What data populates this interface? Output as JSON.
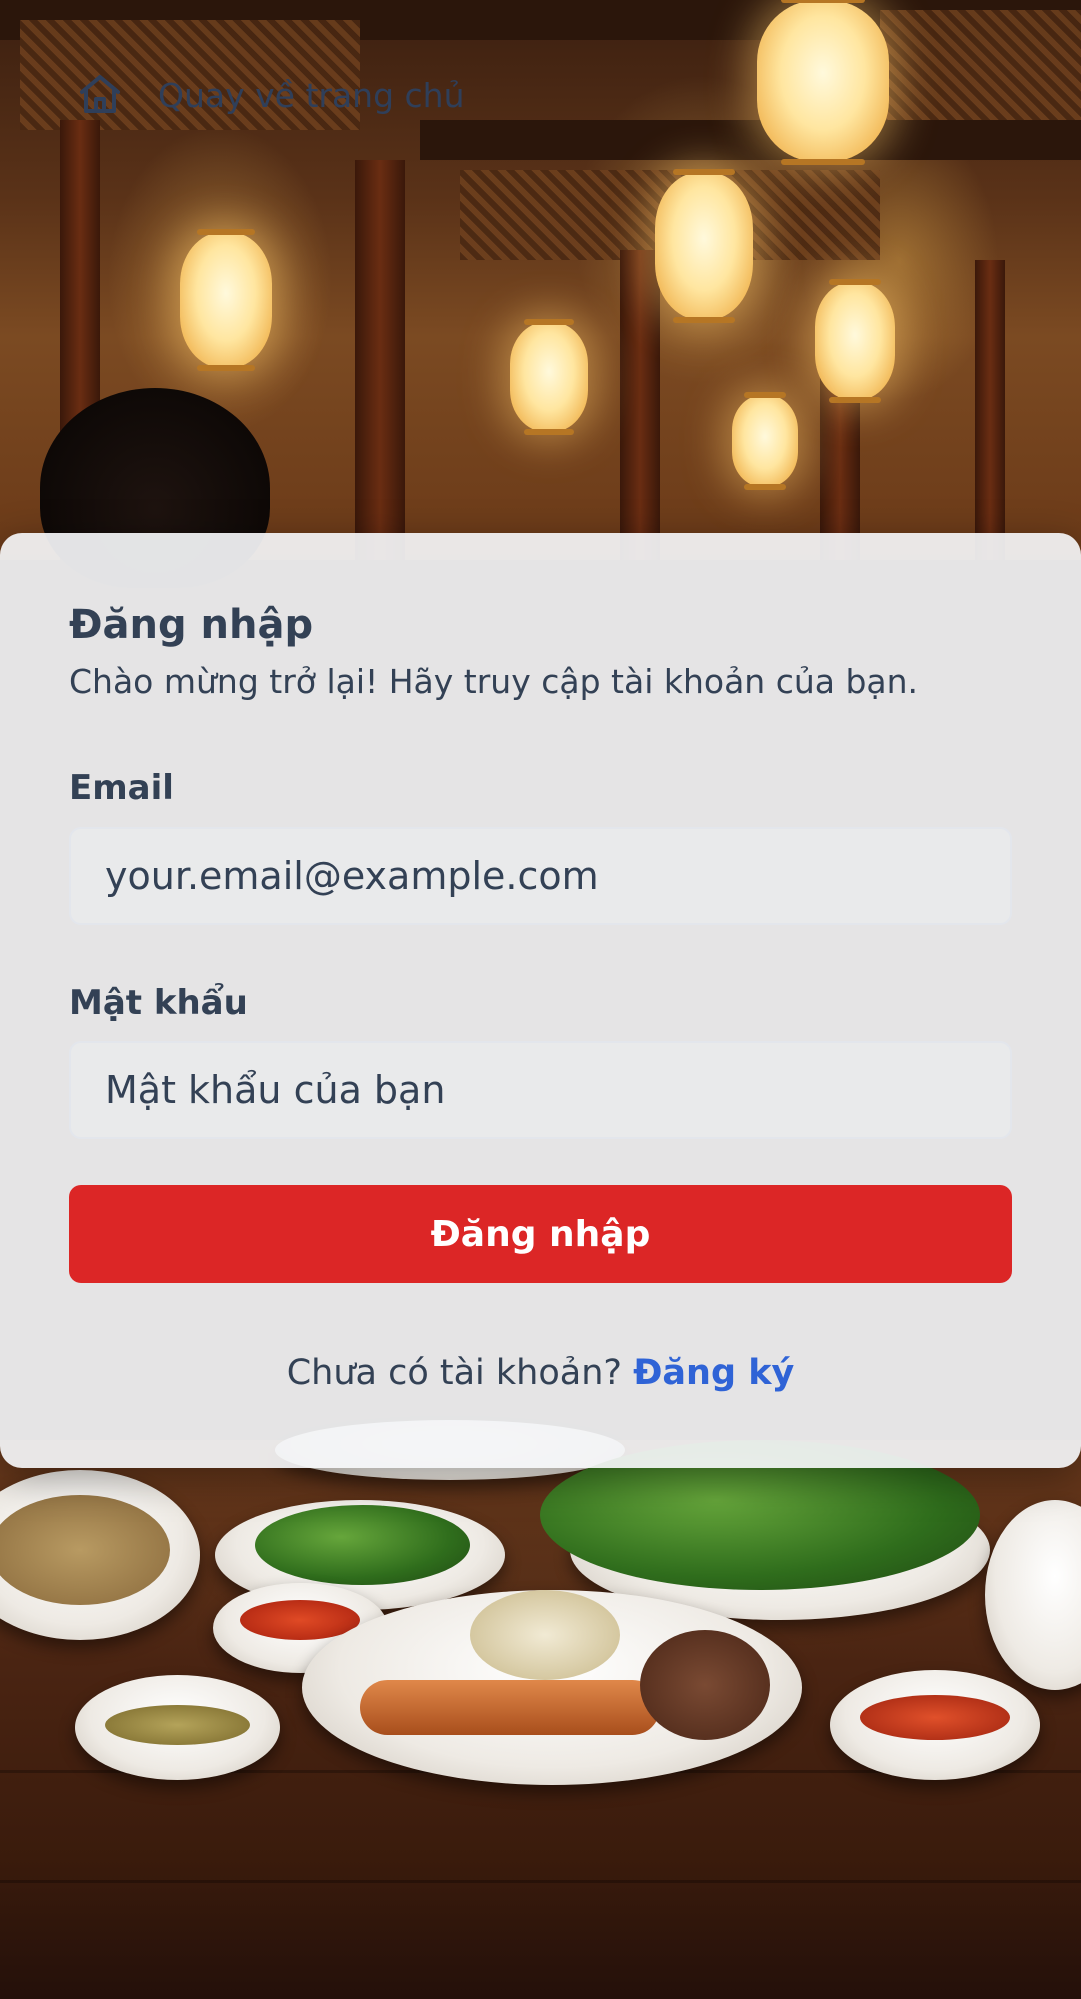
{
  "nav": {
    "back_label": "Quay về trang chủ",
    "home_icon": "home-icon"
  },
  "login": {
    "title": "Đăng nhập",
    "subtitle": "Chào mừng trở lại! Hãy truy cập tài khoản của bạn.",
    "email_label": "Email",
    "email_placeholder": "your.email@example.com",
    "email_value": "",
    "password_label": "Mật khẩu",
    "password_placeholder": "Mật khẩu của bạn",
    "password_value": "",
    "submit_label": "Đăng nhập",
    "signup_prompt": "Chưa có tài khoản?",
    "signup_link": "Đăng ký"
  },
  "colors": {
    "primary_button": "#dc2626",
    "link": "#2f63d6",
    "text": "#334155"
  }
}
